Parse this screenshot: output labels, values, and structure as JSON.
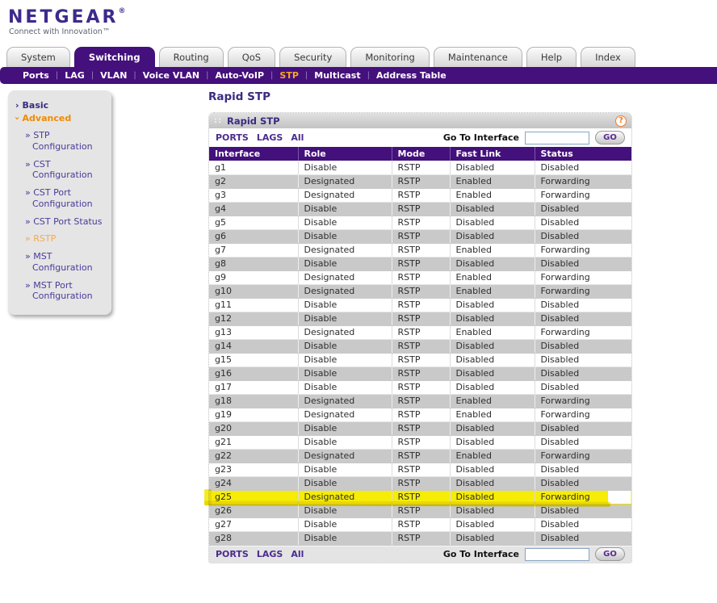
{
  "brand": {
    "logo": "NETGEAR",
    "registered_mark": "®",
    "tagline": "Connect with Innovation™"
  },
  "tabs": [
    {
      "label": "System",
      "active": false
    },
    {
      "label": "Switching",
      "active": true
    },
    {
      "label": "Routing",
      "active": false
    },
    {
      "label": "QoS",
      "active": false
    },
    {
      "label": "Security",
      "active": false
    },
    {
      "label": "Monitoring",
      "active": false
    },
    {
      "label": "Maintenance",
      "active": false
    },
    {
      "label": "Help",
      "active": false
    },
    {
      "label": "Index",
      "active": false
    }
  ],
  "subnav": [
    {
      "label": "Ports",
      "active": false
    },
    {
      "label": "LAG",
      "active": false
    },
    {
      "label": "VLAN",
      "active": false
    },
    {
      "label": "Voice VLAN",
      "active": false
    },
    {
      "label": "Auto-VoIP",
      "active": false
    },
    {
      "label": "STP",
      "active": true
    },
    {
      "label": "Multicast",
      "active": false
    },
    {
      "label": "Address Table",
      "active": false
    }
  ],
  "sidebar": {
    "section_arrow": "›",
    "item_bullet": "»",
    "sections": [
      {
        "label": "Basic",
        "expanded": false,
        "items": []
      },
      {
        "label": "Advanced",
        "expanded": true,
        "selected_item": "RSTP",
        "items": [
          "STP Configuration",
          "CST Configuration",
          "CST Port Configuration",
          "CST Port Status",
          "RSTP",
          "MST Configuration",
          "MST Port Configuration"
        ]
      }
    ]
  },
  "page": {
    "title": "Rapid STP"
  },
  "panel": {
    "title": "Rapid STP",
    "icons": {
      "grip": "::",
      "help": "?"
    },
    "toolbar": {
      "links": [
        "PORTS",
        "LAGS",
        "All"
      ],
      "goto_label": "Go To Interface",
      "goto_value": "",
      "go_label": "GO"
    },
    "table": {
      "columns": [
        "Interface",
        "Role",
        "Mode",
        "Fast Link",
        "Status"
      ],
      "rows": [
        {
          "interface": "g1",
          "role": "Disable",
          "mode": "RSTP",
          "fast_link": "Disabled",
          "status": "Disabled",
          "highlighted": false
        },
        {
          "interface": "g2",
          "role": "Designated",
          "mode": "RSTP",
          "fast_link": "Enabled",
          "status": "Forwarding",
          "highlighted": false
        },
        {
          "interface": "g3",
          "role": "Designated",
          "mode": "RSTP",
          "fast_link": "Enabled",
          "status": "Forwarding",
          "highlighted": false
        },
        {
          "interface": "g4",
          "role": "Disable",
          "mode": "RSTP",
          "fast_link": "Disabled",
          "status": "Disabled",
          "highlighted": false
        },
        {
          "interface": "g5",
          "role": "Disable",
          "mode": "RSTP",
          "fast_link": "Disabled",
          "status": "Disabled",
          "highlighted": false
        },
        {
          "interface": "g6",
          "role": "Disable",
          "mode": "RSTP",
          "fast_link": "Disabled",
          "status": "Disabled",
          "highlighted": false
        },
        {
          "interface": "g7",
          "role": "Designated",
          "mode": "RSTP",
          "fast_link": "Enabled",
          "status": "Forwarding",
          "highlighted": false
        },
        {
          "interface": "g8",
          "role": "Disable",
          "mode": "RSTP",
          "fast_link": "Disabled",
          "status": "Disabled",
          "highlighted": false
        },
        {
          "interface": "g9",
          "role": "Designated",
          "mode": "RSTP",
          "fast_link": "Enabled",
          "status": "Forwarding",
          "highlighted": false
        },
        {
          "interface": "g10",
          "role": "Designated",
          "mode": "RSTP",
          "fast_link": "Enabled",
          "status": "Forwarding",
          "highlighted": false
        },
        {
          "interface": "g11",
          "role": "Disable",
          "mode": "RSTP",
          "fast_link": "Disabled",
          "status": "Disabled",
          "highlighted": false
        },
        {
          "interface": "g12",
          "role": "Disable",
          "mode": "RSTP",
          "fast_link": "Disabled",
          "status": "Disabled",
          "highlighted": false
        },
        {
          "interface": "g13",
          "role": "Designated",
          "mode": "RSTP",
          "fast_link": "Enabled",
          "status": "Forwarding",
          "highlighted": false
        },
        {
          "interface": "g14",
          "role": "Disable",
          "mode": "RSTP",
          "fast_link": "Disabled",
          "status": "Disabled",
          "highlighted": false
        },
        {
          "interface": "g15",
          "role": "Disable",
          "mode": "RSTP",
          "fast_link": "Disabled",
          "status": "Disabled",
          "highlighted": false
        },
        {
          "interface": "g16",
          "role": "Disable",
          "mode": "RSTP",
          "fast_link": "Disabled",
          "status": "Disabled",
          "highlighted": false
        },
        {
          "interface": "g17",
          "role": "Disable",
          "mode": "RSTP",
          "fast_link": "Disabled",
          "status": "Disabled",
          "highlighted": false
        },
        {
          "interface": "g18",
          "role": "Designated",
          "mode": "RSTP",
          "fast_link": "Enabled",
          "status": "Forwarding",
          "highlighted": false
        },
        {
          "interface": "g19",
          "role": "Designated",
          "mode": "RSTP",
          "fast_link": "Enabled",
          "status": "Forwarding",
          "highlighted": false
        },
        {
          "interface": "g20",
          "role": "Disable",
          "mode": "RSTP",
          "fast_link": "Disabled",
          "status": "Disabled",
          "highlighted": false
        },
        {
          "interface": "g21",
          "role": "Disable",
          "mode": "RSTP",
          "fast_link": "Disabled",
          "status": "Disabled",
          "highlighted": false
        },
        {
          "interface": "g22",
          "role": "Designated",
          "mode": "RSTP",
          "fast_link": "Enabled",
          "status": "Forwarding",
          "highlighted": false
        },
        {
          "interface": "g23",
          "role": "Disable",
          "mode": "RSTP",
          "fast_link": "Disabled",
          "status": "Disabled",
          "highlighted": false
        },
        {
          "interface": "g24",
          "role": "Disable",
          "mode": "RSTP",
          "fast_link": "Disabled",
          "status": "Disabled",
          "highlighted": false
        },
        {
          "interface": "g25",
          "role": "Designated",
          "mode": "RSTP",
          "fast_link": "Disabled",
          "status": "Forwarding",
          "highlighted": true
        },
        {
          "interface": "g26",
          "role": "Disable",
          "mode": "RSTP",
          "fast_link": "Disabled",
          "status": "Disabled",
          "highlighted": false
        },
        {
          "interface": "g27",
          "role": "Disable",
          "mode": "RSTP",
          "fast_link": "Disabled",
          "status": "Disabled",
          "highlighted": false
        },
        {
          "interface": "g28",
          "role": "Disable",
          "mode": "RSTP",
          "fast_link": "Disabled",
          "status": "Disabled",
          "highlighted": false
        }
      ]
    }
  },
  "colors": {
    "brand_purple": "#44107c",
    "link_purple": "#4b2c8f",
    "accent_orange": "#ef8b00",
    "subnav_active_orange": "#f7a823",
    "sidebar_selected_orange": "#f2a94e",
    "row_alt_gray": "#c9c9c9",
    "highlight_yellow": "#f2e803"
  }
}
